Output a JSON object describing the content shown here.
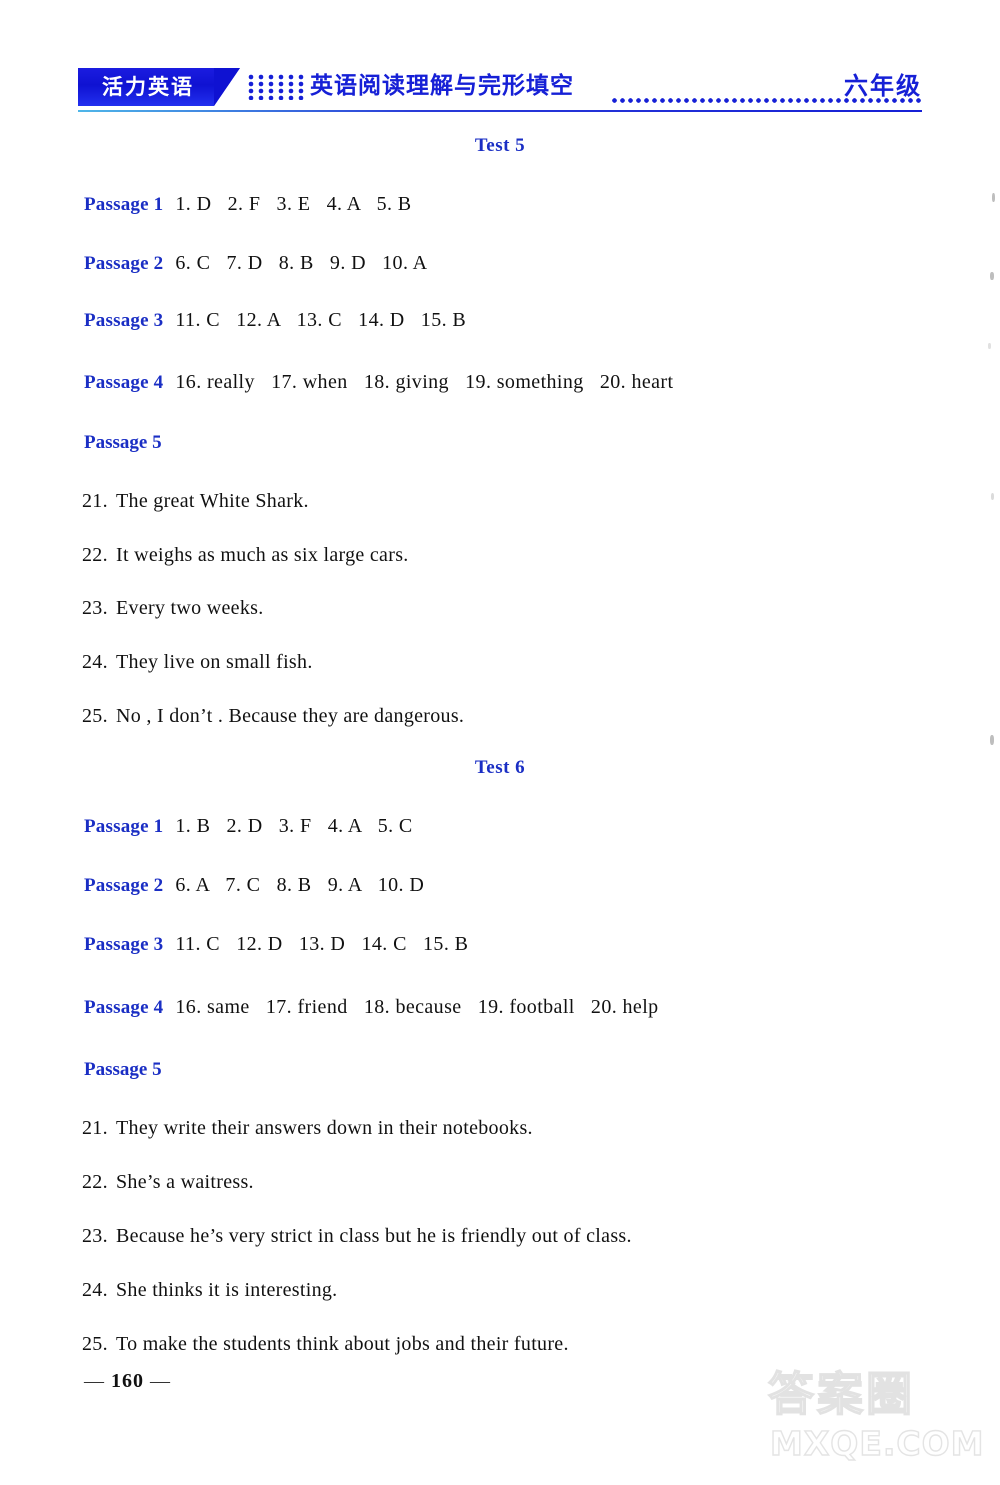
{
  "header": {
    "brand": "活力英语",
    "title": "英语阅读理解与完形填空",
    "grade": "六年级"
  },
  "tests": [
    {
      "title": "Test 5",
      "passages": [
        {
          "label": "Passage 1",
          "answers": "1. D   2. F   3. E   4. A   5. B"
        },
        {
          "label": "Passage 2",
          "answers": "6. C   7. D   8. B   9. D   10. A"
        },
        {
          "label": "Passage 3",
          "answers": "11. C   12. A   13. C   14. D   15. B"
        },
        {
          "label": "Passage 4",
          "answers": "16. really   17. when   18. giving   19. something   20. heart"
        }
      ],
      "passage5_label": "Passage 5",
      "passage5_answers": [
        {
          "number": "21.",
          "text": "The great White Shark."
        },
        {
          "number": "22.",
          "text": "It weighs as much as six large cars."
        },
        {
          "number": "23.",
          "text": "Every two weeks."
        },
        {
          "number": "24.",
          "text": "They live on small fish."
        },
        {
          "number": "25.",
          "text": "No , I don’t . Because they are dangerous."
        }
      ]
    },
    {
      "title": "Test 6",
      "passages": [
        {
          "label": "Passage 1",
          "answers": "1. B   2. D   3. F   4. A   5. C"
        },
        {
          "label": "Passage 2",
          "answers": "6. A   7. C   8. B   9. A   10. D"
        },
        {
          "label": "Passage 3",
          "answers": "11. C   12. D   13. D   14. C   15. B"
        },
        {
          "label": "Passage 4",
          "answers": "16. same   17. friend   18. because   19. football   20. help"
        }
      ],
      "passage5_label": "Passage 5",
      "passage5_answers": [
        {
          "number": "21.",
          "text": "They write their answers down in their notebooks."
        },
        {
          "number": "22.",
          "text": "She’s a waitress."
        },
        {
          "number": "23.",
          "text": "Because he’s very strict in class but he is friendly out of class."
        },
        {
          "number": "24.",
          "text": "She thinks it is interesting."
        },
        {
          "number": "25.",
          "text": "To make the students think about jobs and their future."
        }
      ]
    }
  ],
  "footer": {
    "page_number": "160",
    "left_dash": "—",
    "right_dash": "—"
  },
  "watermark": {
    "chinese": "答案圈",
    "domain": "MXQE.COM"
  },
  "colors": {
    "brand_blue": "#1620d6",
    "heading_blue": "#1a2ec4",
    "body_black": "#111111"
  }
}
